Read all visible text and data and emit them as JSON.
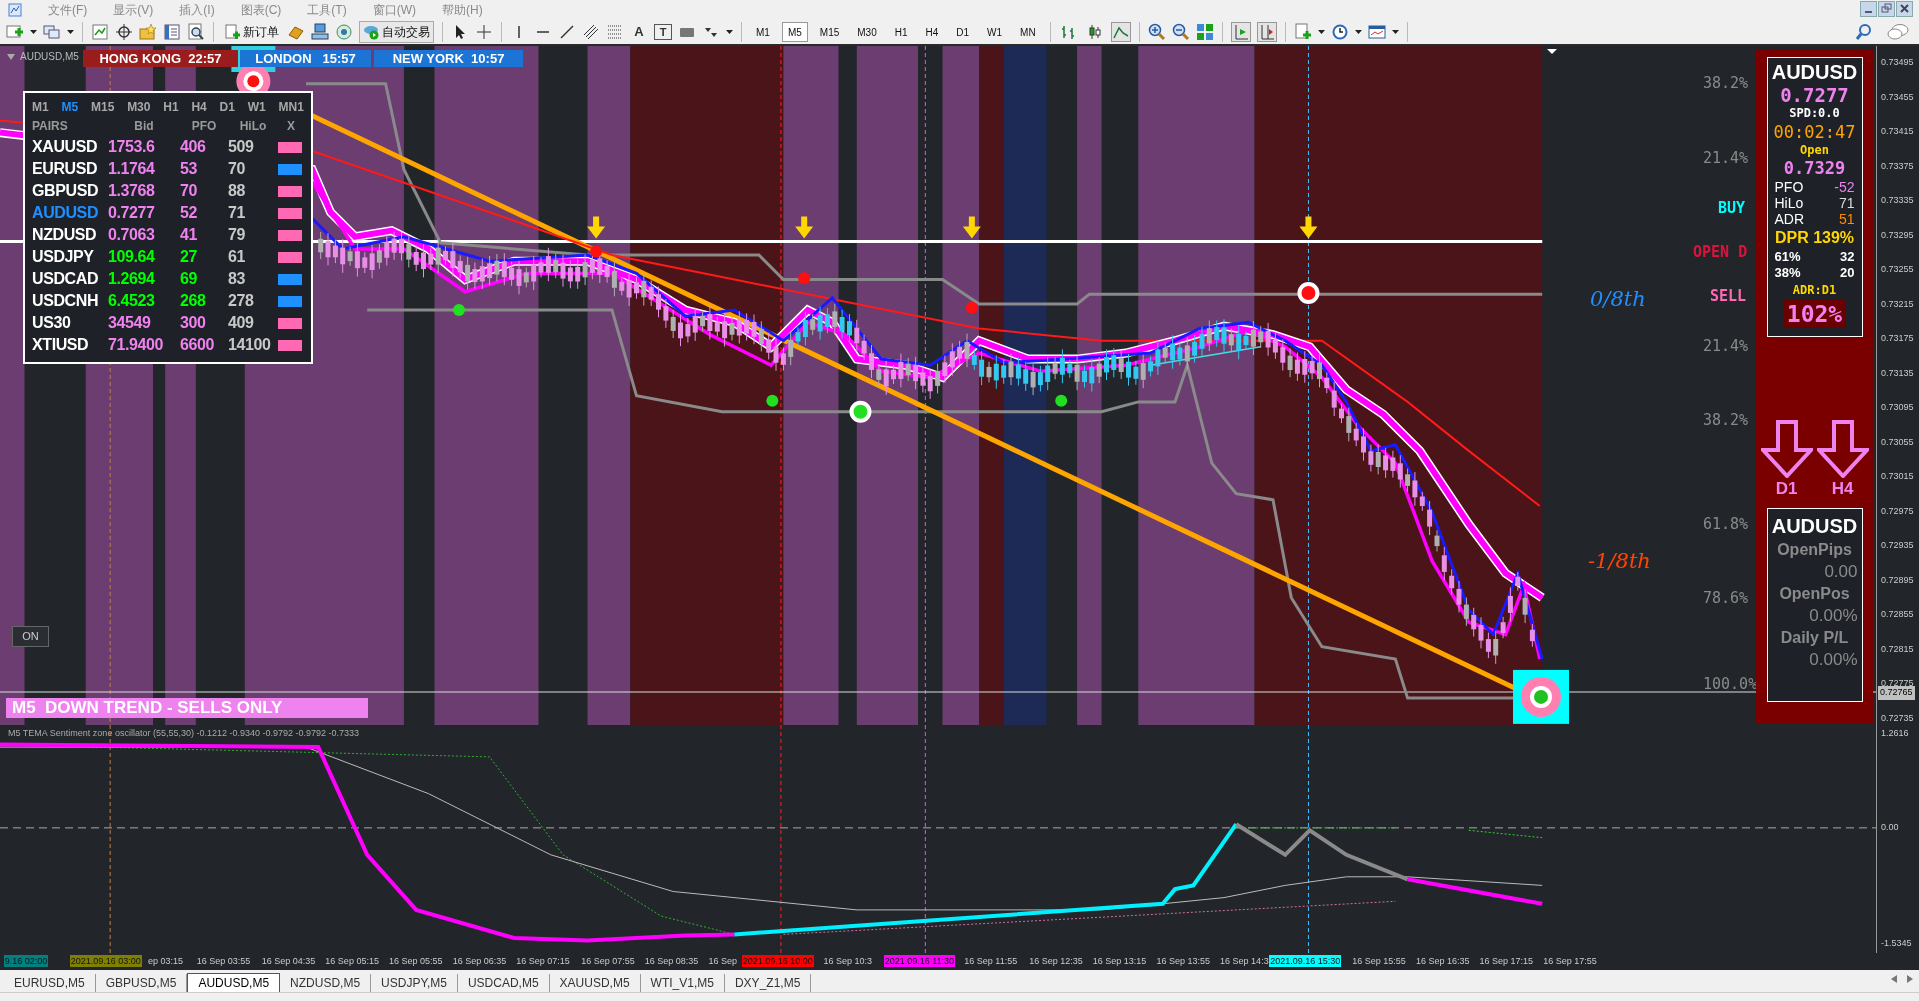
{
  "menu": [
    "文件(F)",
    "显示(V)",
    "插入(I)",
    "图表(C)",
    "工具(T)",
    "窗口(W)",
    "帮助(H)"
  ],
  "toolbar": {
    "new_order": "新订单",
    "auto_trading": "自动交易",
    "text_tool": "A",
    "text_label_tool": "T",
    "timeframes": [
      {
        "label": "M1",
        "selected": false
      },
      {
        "label": "M5",
        "selected": true
      },
      {
        "label": "M15",
        "selected": false
      },
      {
        "label": "M30",
        "selected": false
      },
      {
        "label": "H1",
        "selected": false
      },
      {
        "label": "H4",
        "selected": false
      },
      {
        "label": "D1",
        "selected": false
      },
      {
        "label": "W1",
        "selected": false
      },
      {
        "label": "MN",
        "selected": false
      }
    ],
    "chart_types": [
      {
        "kind": "bars",
        "selected": false
      },
      {
        "kind": "candles",
        "selected": false
      },
      {
        "kind": "line",
        "selected": true
      }
    ],
    "auto_scroll": true,
    "chart_shift": true
  },
  "chart": {
    "title": "AUDUSD,M5",
    "clocks": [
      {
        "label": "HONG KONG  22:57",
        "color": "#9b1c1c"
      },
      {
        "label": "LONDON   15:57",
        "color": "#1c74d4"
      },
      {
        "label": "NEW YORK  10:57",
        "color": "#1c74d4"
      }
    ],
    "pairs_table": {
      "timeframes": [
        {
          "label": "M1",
          "selected": false
        },
        {
          "label": "M5",
          "selected": true
        },
        {
          "label": "M15",
          "selected": false
        },
        {
          "label": "M30",
          "selected": false
        },
        {
          "label": "H1",
          "selected": false
        },
        {
          "label": "H4",
          "selected": false
        },
        {
          "label": "D1",
          "selected": false
        },
        {
          "label": "W1",
          "selected": false
        },
        {
          "label": "MN1",
          "selected": false
        }
      ],
      "columns": [
        "PAIRS",
        "Bid",
        "PFO",
        "HiLo",
        "X"
      ],
      "rows": [
        {
          "pair": "XAUUSD",
          "bid": "1753.6",
          "pfo": "406",
          "hilo": "509",
          "rising": false,
          "color": "#ff69b4",
          "selected": false
        },
        {
          "pair": "EURUSD",
          "bid": "1.1764",
          "pfo": "53",
          "hilo": "70",
          "rising": false,
          "color": "#1e90ff",
          "selected": false
        },
        {
          "pair": "GBPUSD",
          "bid": "1.3768",
          "pfo": "70",
          "hilo": "88",
          "rising": false,
          "color": "#ff69b4",
          "selected": false
        },
        {
          "pair": "AUDUSD",
          "bid": "0.7277",
          "pfo": "52",
          "hilo": "71",
          "rising": false,
          "color": "#ff69b4",
          "selected": true
        },
        {
          "pair": "NZDUSD",
          "bid": "0.7063",
          "pfo": "41",
          "hilo": "79",
          "rising": false,
          "color": "#ff69b4",
          "selected": false
        },
        {
          "pair": "USDJPY",
          "bid": "109.64",
          "pfo": "27",
          "hilo": "61",
          "rising": true,
          "color": "#ff69b4",
          "selected": false
        },
        {
          "pair": "USDCAD",
          "bid": "1.2694",
          "pfo": "69",
          "hilo": "83",
          "rising": true,
          "color": "#1e90ff",
          "selected": false
        },
        {
          "pair": "USDCNH",
          "bid": "6.4523",
          "pfo": "268",
          "hilo": "278",
          "rising": true,
          "color": "#1e90ff",
          "selected": false
        },
        {
          "pair": "US30",
          "bid": "34549",
          "pfo": "300",
          "hilo": "409",
          "rising": false,
          "color": "#ff69b4",
          "selected": false
        },
        {
          "pair": "XTIUSD",
          "bid": "71.9400",
          "pfo": "6600",
          "hilo": "14100",
          "rising": false,
          "color": "#ff69b4",
          "selected": false
        }
      ]
    },
    "fib_levels": [
      "38.2%",
      "21.4%",
      "21.4%",
      "38.2%",
      "61.8%",
      "78.6%",
      "100.0%"
    ],
    "signal_labels": [
      {
        "label": "BUY",
        "color": "#00ffff"
      },
      {
        "label": "OPEN D",
        "color": "#dc143c"
      },
      {
        "label": "SELL",
        "color": "#ff69b4"
      }
    ],
    "octave_labels": [
      {
        "label": "0/8th",
        "color": "#1e90ff"
      },
      {
        "label": "-1/8th",
        "color": "#ff4500"
      }
    ],
    "on_button": "ON",
    "trend_banner": "M5  DOWN TREND - SELLS ONLY",
    "info_panel": {
      "symbol": "AUDUSD",
      "bid": "0.7277",
      "spread": "SPD:0.0",
      "countdown": "00:02:47",
      "open_label": "Open",
      "open": "0.7329",
      "stats": [
        {
          "label": "PFO",
          "value": "-52",
          "color": "#ee82ee"
        },
        {
          "label": "HiLo",
          "value": "71",
          "color": "#dcdcdc"
        },
        {
          "label": "ADR",
          "value": "51",
          "color": "#ff8c00"
        }
      ],
      "dpr": "DPR 139%",
      "levels": [
        {
          "label": "61%",
          "value": "32"
        },
        {
          "label": "38%",
          "value": "20"
        }
      ],
      "adr_label": "ADR:D1",
      "adr_percent": "102%"
    },
    "trend_arrows": [
      {
        "label": "D1",
        "pointing_down": true
      },
      {
        "label": "H4",
        "pointing_down": true
      }
    ],
    "position_panel": {
      "symbol": "AUDUSD",
      "rows": [
        {
          "label": "OpenPips",
          "value": "0.00"
        },
        {
          "label": "OpenPos",
          "value": "0.00%"
        },
        {
          "label": "Daily P/L",
          "value": "0.00%"
        }
      ]
    },
    "price_axis": [
      "0.73495",
      "0.73455",
      "0.73415",
      "0.73375",
      "0.73335",
      "0.73295",
      "0.73255",
      "0.73215",
      "0.73175",
      "0.73135",
      "0.73095",
      "0.73055",
      "0.73015",
      "0.72975",
      "0.72935",
      "0.72895",
      "0.72855",
      "0.72815",
      "0.72775",
      "0.72735"
    ],
    "current_price": "0.72765"
  },
  "indicator": {
    "label": "M5 TEMA Sentiment zone oscillator (55,55,30) -0.1212 -0.9340 -0.9792 -0.9792 -0.7333",
    "axis": [
      "1.2616",
      "0.00",
      "-1.5345"
    ]
  },
  "time_axis": [
    {
      "label": "9.16 02:00",
      "color": "#008080"
    },
    {
      "label": "2021.09.16 03:00",
      "color": "#808000"
    },
    {
      "label": "ep 03:15"
    },
    {
      "label": "16 Sep 03:55"
    },
    {
      "label": "16 Sep 04:35"
    },
    {
      "label": "16 Sep 05:15"
    },
    {
      "label": "16 Sep 05:55"
    },
    {
      "label": "16 Sep 06:35"
    },
    {
      "label": "16 Sep 07:15"
    },
    {
      "label": "16 Sep 07:55"
    },
    {
      "label": "16 Sep 08:35"
    },
    {
      "label": "16 Sep"
    },
    {
      "label": "2021.09.16 10:00",
      "color": "#ff0000"
    },
    {
      "label": "16 Sep 10:3"
    },
    {
      "label": "2021.09.16 11:30",
      "color": "#ff00ff"
    },
    {
      "label": "16 Sep 11:55"
    },
    {
      "label": "16 Sep 12:35"
    },
    {
      "label": "16 Sep 13:15"
    },
    {
      "label": "16 Sep 13:55"
    },
    {
      "label": "16 Sep 14:3"
    },
    {
      "label": "2021.09.16 15:30",
      "color": "#00ffff"
    },
    {
      "label": "16 Sep 15:55"
    },
    {
      "label": "16 Sep 16:35"
    },
    {
      "label": "16 Sep 17:15"
    },
    {
      "label": "16 Sep 17:55"
    }
  ],
  "tabs": [
    {
      "label": "EURUSD,M5",
      "selected": false
    },
    {
      "label": "GBPUSD,M5",
      "selected": false
    },
    {
      "label": "AUDUSD,M5",
      "selected": true
    },
    {
      "label": "NZDUSD,M5",
      "selected": false
    },
    {
      "label": "USDJPY,M5",
      "selected": false
    },
    {
      "label": "USDCAD,M5",
      "selected": false
    },
    {
      "label": "XAUUSD,M5",
      "selected": false
    },
    {
      "label": "WTI_V1,M5",
      "selected": false
    },
    {
      "label": "DXY_Z1,M5",
      "selected": false
    }
  ]
}
